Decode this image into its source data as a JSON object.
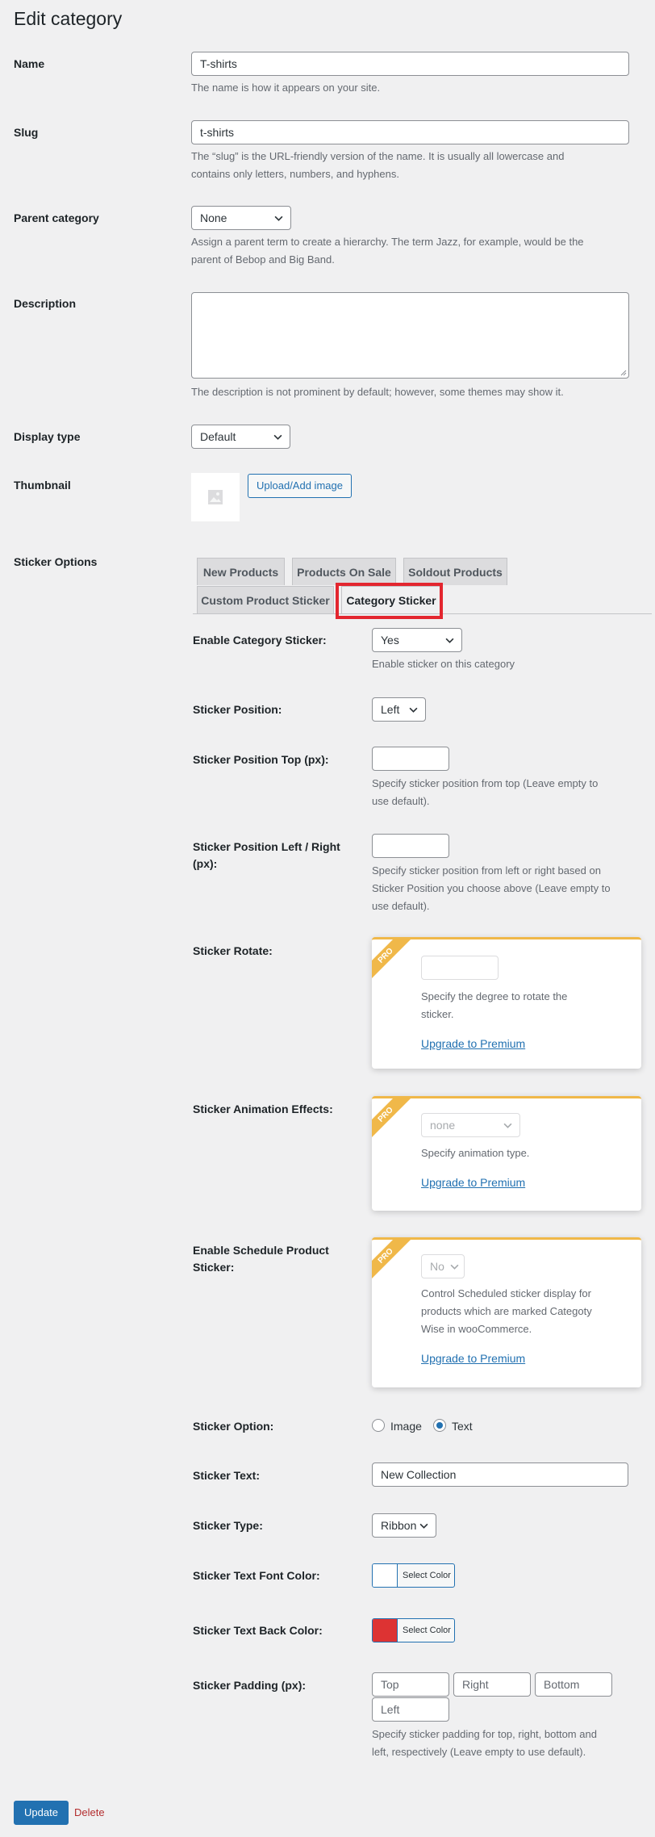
{
  "page": {
    "title": "Edit category"
  },
  "fields": {
    "name": {
      "label": "Name",
      "value": "T-shirts",
      "description": "The name is how it appears on your site."
    },
    "slug": {
      "label": "Slug",
      "value": "t-shirts",
      "description_line1": "The “slug” is the URL-friendly version of the name. It is usually all lowercase and",
      "description_line2": "contains only letters, numbers, and hyphens."
    },
    "parent": {
      "label": "Parent category",
      "value": "None",
      "description_line1": "Assign a parent term to create a hierarchy. The term Jazz, for example, would be the",
      "description_line2": "parent of Bebop and Big Band."
    },
    "description": {
      "label": "Description",
      "value": "",
      "description": "The description is not prominent by default; however, some themes may show it."
    },
    "display_type": {
      "label": "Display type",
      "value": "Default"
    },
    "thumbnail": {
      "label": "Thumbnail",
      "button": "Upload/Add image"
    }
  },
  "sticker": {
    "label": "Sticker Options",
    "tabs": [
      "New Products",
      "Products On Sale",
      "Soldout Products",
      "Custom Product Sticker",
      "Category Sticker"
    ],
    "active_tab": "Category Sticker",
    "enable": {
      "label": "Enable Category Sticker:",
      "value": "Yes",
      "description": "Enable sticker on this category"
    },
    "position": {
      "label": "Sticker Position:",
      "value": "Left"
    },
    "pos_top": {
      "label": "Sticker Position Top (px):",
      "value": "",
      "description_line1": "Specify sticker position from top (Leave empty to",
      "description_line2": "use default)."
    },
    "pos_side": {
      "label_line1": "Sticker Position Left / Right",
      "label_line2": "(px):",
      "value": "",
      "description_line1": "Specify sticker position from left or right based on",
      "description_line2": "Sticker Position you choose above (Leave empty to",
      "description_line3": "use default)."
    },
    "rotate": {
      "label": "Sticker Rotate:",
      "badge": "PRO",
      "value": "",
      "description_line1": "Specify the degree to rotate the",
      "description_line2": "sticker.",
      "link": "Upgrade to Premium"
    },
    "animation": {
      "label": "Sticker Animation Effects:",
      "badge": "PRO",
      "value": "none",
      "description": "Specify animation type.",
      "link": "Upgrade to Premium"
    },
    "schedule": {
      "label_line1": "Enable Schedule Product",
      "label_line2": "Sticker:",
      "badge": "PRO",
      "value": "No",
      "description_line1": "Control Scheduled sticker display for",
      "description_line2": "products which are marked Categoty",
      "description_line3": "Wise in wooCommerce.",
      "link": "Upgrade to Premium"
    },
    "option": {
      "label": "Sticker Option:",
      "choices": [
        "Image",
        "Text"
      ],
      "selected": "Text"
    },
    "text": {
      "label": "Sticker Text:",
      "value": "New Collection"
    },
    "type": {
      "label": "Sticker Type:",
      "value": "Ribbon"
    },
    "font_color": {
      "label": "Sticker Text Font Color:",
      "button": "Select Color",
      "color": "#ffffff"
    },
    "back_color": {
      "label": "Sticker Text Back Color:",
      "button": "Select Color",
      "color": "#dd3333"
    },
    "padding": {
      "label": "Sticker Padding (px):",
      "placeholders": [
        "Top",
        "Right",
        "Bottom",
        "Left"
      ],
      "description_line1": "Specify sticker padding for top, right, bottom and",
      "description_line2": "left, respectively (Leave empty to use default)."
    }
  },
  "actions": {
    "update": "Update",
    "delete": "Delete"
  },
  "colors": {
    "primary": "#2271b1",
    "highlight": "#e3262f",
    "pro": "#f0b849"
  }
}
